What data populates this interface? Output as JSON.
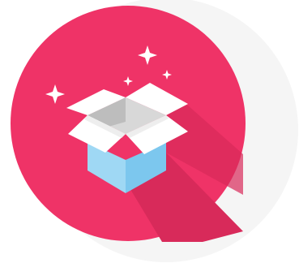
{
  "icon": {
    "name": "open-box-icon",
    "colors": {
      "background": "#ffffff",
      "shadow_disc": "#f5f5f5",
      "circle": "#ef3367",
      "long_shadow": "#d82a5a",
      "box_front_left": "#9fd8f4",
      "box_front_right": "#7cc7ee",
      "box_inner": "#d8d8d8",
      "box_inner_dark": "#bdbdbd",
      "flaps": "#ffffff",
      "flap_shade": "#eeeeee",
      "sparkles": "#ffffff"
    }
  }
}
